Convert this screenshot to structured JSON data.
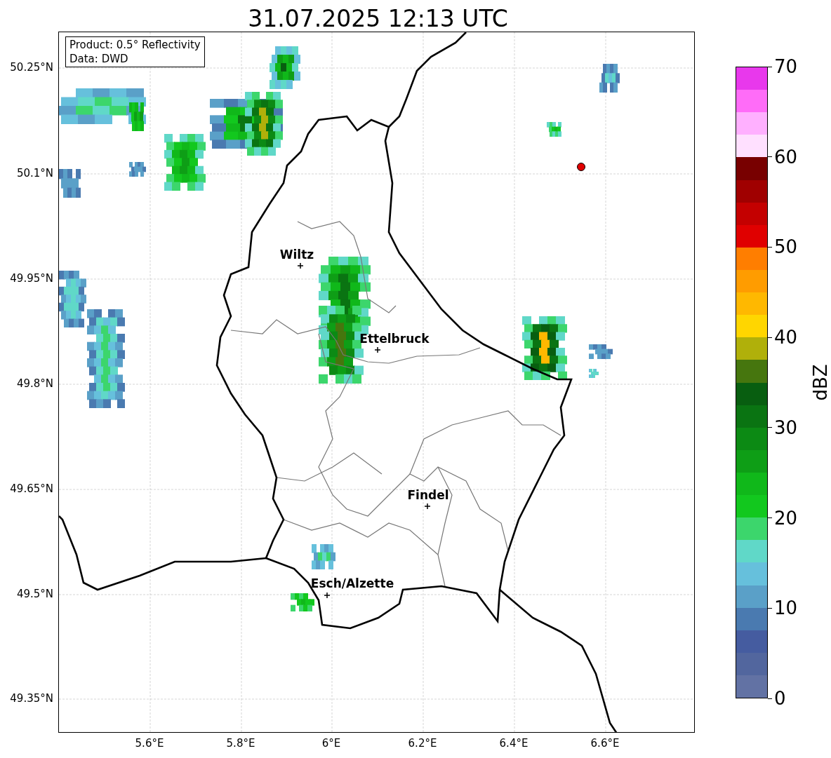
{
  "title": "31.07.2025 12:13 UTC",
  "info_box": {
    "lines": [
      "Product: 0.5° Reflectivity",
      "Data: DWD"
    ]
  },
  "map": {
    "y_ticks": [
      "50.25°N",
      "50.1°N",
      "49.95°N",
      "49.8°N",
      "49.65°N",
      "49.5°N",
      "49.35°N"
    ],
    "x_ticks": [
      "5.6°E",
      "5.8°E",
      "6°E",
      "6.2°E",
      "6.4°E",
      "6.6°E"
    ],
    "cities": [
      {
        "name": "Wiltz"
      },
      {
        "name": "Ettelbruck"
      },
      {
        "name": "Findel"
      },
      {
        "name": "Esch/Alzette"
      }
    ]
  },
  "colorbar": {
    "label": "dBZ",
    "ticks": [
      "70",
      "60",
      "50",
      "40",
      "30",
      "20",
      "10",
      "0"
    ],
    "bands": [
      {
        "color": "#e838ec"
      },
      {
        "color": "#ff6cf8"
      },
      {
        "color": "#ffb0ff"
      },
      {
        "color": "#ffe0ff"
      },
      {
        "color": "#780000"
      },
      {
        "color": "#a00000"
      },
      {
        "color": "#c40000"
      },
      {
        "color": "#e00000"
      },
      {
        "color": "#ff7e00"
      },
      {
        "color": "#ff9c00"
      },
      {
        "color": "#ffb800"
      },
      {
        "color": "#ffd600"
      },
      {
        "color": "#b0b00a"
      },
      {
        "color": "#46760e"
      },
      {
        "color": "#085e10"
      },
      {
        "color": "#0a7412"
      },
      {
        "color": "#0c8a14"
      },
      {
        "color": "#0e9e16"
      },
      {
        "color": "#10b81a"
      },
      {
        "color": "#12c81e"
      },
      {
        "color": "#3cd66c"
      },
      {
        "color": "#60d8c8"
      },
      {
        "color": "#66c0dc"
      },
      {
        "color": "#5aa0c8"
      },
      {
        "color": "#4a7ab0"
      },
      {
        "color": "#455ca0"
      },
      {
        "color": "#52669e"
      },
      {
        "color": "#6272a4"
      }
    ]
  }
}
